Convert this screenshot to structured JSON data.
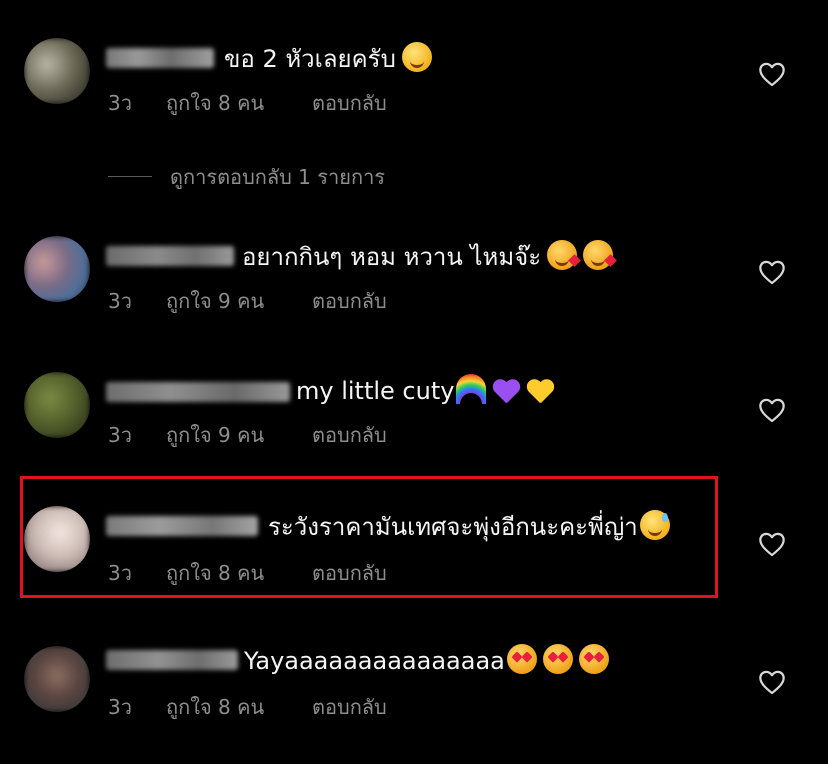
{
  "labels": {
    "reply": "ตอบกลับ"
  },
  "view_replies": "ดูการตอบกลับ 1 รายการ",
  "comments": [
    {
      "username": "username",
      "text": "ขอ 2 หัวเลยครับ",
      "emojis": [
        "smile"
      ],
      "age": "3ว",
      "likes": "ถูกใจ 8 คน"
    },
    {
      "username": "username",
      "text": "อยากกินๆ หอม หวาน ไหมจ๊ะ",
      "emojis": [
        "kiss",
        "kiss"
      ],
      "age": "3ว",
      "likes": "ถูกใจ 9 คน"
    },
    {
      "username": "username",
      "text": "my little cuty",
      "emojis": [
        "rainbow",
        "purple-heart",
        "yellow-heart"
      ],
      "age": "3ว",
      "likes": "ถูกใจ 9 คน"
    },
    {
      "username": "username",
      "text": "ระวังราคามันเทศจะพุ่งอีกนะคะพี่ญ่า",
      "emojis": [
        "sweat-smile"
      ],
      "age": "3ว",
      "likes": "ถูกใจ 8 คน",
      "highlighted": true
    },
    {
      "username": "username",
      "text": "Yayaaaaaaaaaaaaaaa",
      "emojis": [
        "heart-eyes",
        "heart-eyes",
        "heart-eyes"
      ],
      "age": "3ว",
      "likes": "ถูกใจ 8 คน"
    }
  ],
  "colors": {
    "background": "#000000",
    "text": "#f5f5f5",
    "meta": "#8e8e8e",
    "highlight": "#e0141e"
  }
}
